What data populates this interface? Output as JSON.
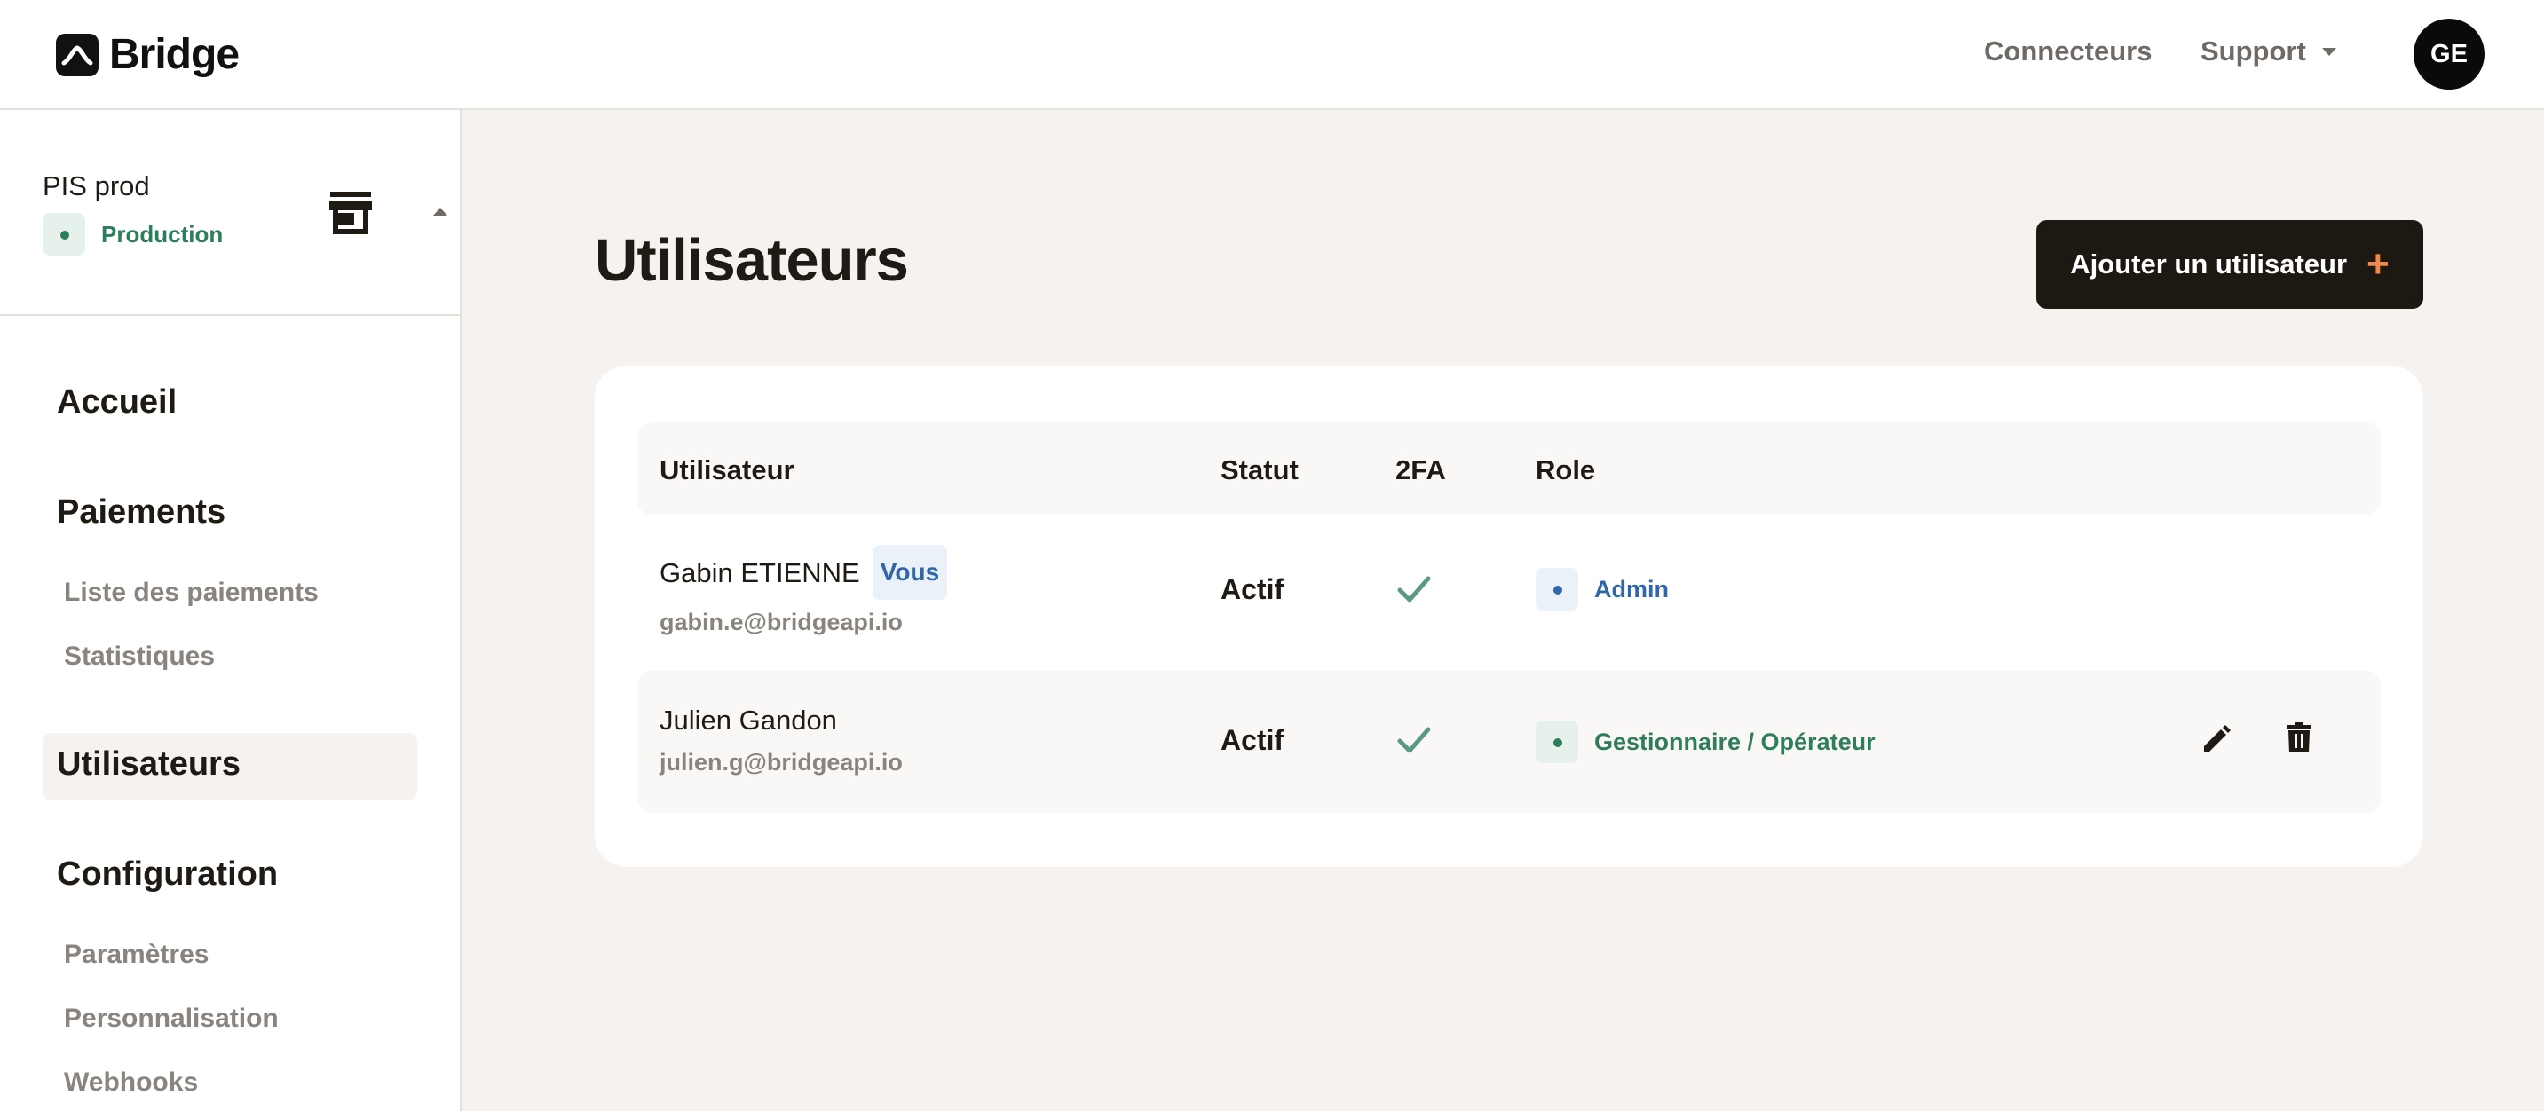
{
  "header": {
    "logo_text": "Bridge",
    "nav": [
      {
        "label": "Connecteurs"
      },
      {
        "label": "Support"
      }
    ],
    "avatar_initials": "GE"
  },
  "sidebar": {
    "environment": {
      "name": "PIS prod",
      "badge": "Production",
      "icon": "store-icon"
    },
    "sections": {
      "accueil": "Accueil",
      "paiements": "Paiements",
      "paiements_items": [
        "Liste des paiements",
        "Statistiques"
      ],
      "utilisateurs": "Utilisateurs",
      "configuration": "Configuration",
      "configuration_items": [
        "Paramètres",
        "Personnalisation",
        "Webhooks"
      ]
    },
    "active_item": "Utilisateurs"
  },
  "main": {
    "title": "Utilisateurs",
    "add_button": "Ajouter un utilisateur",
    "table": {
      "columns": [
        "Utilisateur",
        "Statut",
        "2FA",
        "Role"
      ],
      "rows": [
        {
          "name": "Gabin ETIENNE",
          "badge": "Vous",
          "email": "gabin.e@bridgeapi.io",
          "status": "Actif",
          "twofa": true,
          "role": "Admin"
        },
        {
          "name": "Julien Gandon",
          "email": "julien.g@bridgeapi.io",
          "status": "Actif",
          "twofa": true,
          "role": "Gestionnaire / Opérateur",
          "actions": [
            "edit-icon",
            "delete-icon"
          ]
        }
      ]
    }
  },
  "colors": {
    "accent_plus": "#ef8a4a",
    "production_green": "#2e7d5b",
    "admin_blue": "#2f67a8",
    "check_green": "#5a9a83",
    "button_dark": "#1e1812"
  }
}
